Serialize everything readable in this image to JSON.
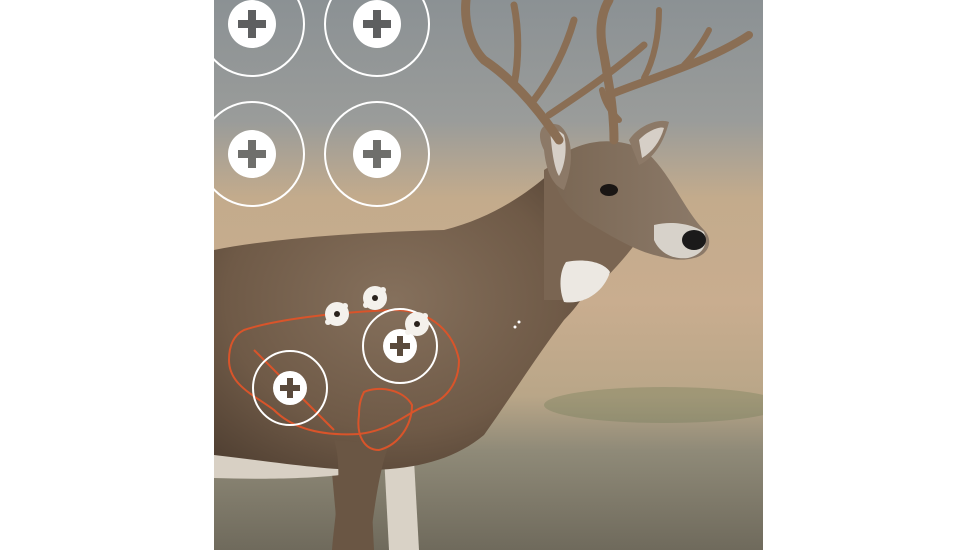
{
  "image": {
    "subject": "whitetail-buck-target",
    "background_color": "#ffffff",
    "sky_top_color": "#8d9396",
    "field_color": "#c4a98a",
    "ground_color": "#7f7768",
    "coat_color": "#7b6350",
    "antler_color": "#8a6e54",
    "vital_outline_color": "#d9542a",
    "target_ring_color": "#ffffff"
  },
  "targets": {
    "icon": "plus-in-circle-icon",
    "count_grid": 4,
    "count_on_body": 2
  },
  "bullet_holes": {
    "icon": "splatter-icon",
    "count": 3
  }
}
